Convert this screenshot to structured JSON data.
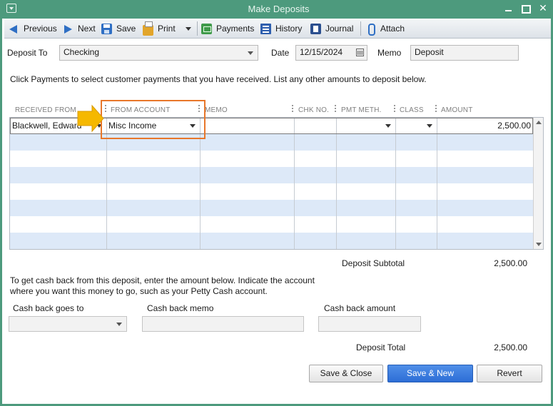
{
  "window": {
    "title": "Make Deposits"
  },
  "toolbar": {
    "previous": "Previous",
    "next": "Next",
    "save": "Save",
    "print": "Print",
    "payments": "Payments",
    "history": "History",
    "journal": "Journal",
    "attach": "Attach"
  },
  "header": {
    "deposit_to_label": "Deposit To",
    "deposit_to_value": "Checking",
    "date_label": "Date",
    "date_value": "12/15/2024",
    "memo_label": "Memo",
    "memo_value": "Deposit"
  },
  "instruction": "Click Payments to select customer payments that you have received. List any other amounts to deposit below.",
  "grid": {
    "columns": [
      "RECEIVED FROM",
      "FROM ACCOUNT",
      "MEMO",
      "CHK NO.",
      "PMT METH.",
      "CLASS",
      "AMOUNT"
    ],
    "rows": [
      {
        "received_from": "Blackwell, Edward",
        "from_account": "Misc Income",
        "memo": "",
        "chk_no": "",
        "pmt_meth": "",
        "class": "",
        "amount": "2,500.00"
      }
    ]
  },
  "totals": {
    "subtotal_label": "Deposit Subtotal",
    "subtotal_value": "2,500.00",
    "total_label": "Deposit Total",
    "total_value": "2,500.00"
  },
  "cash_back": {
    "instruction_line1": "To get cash back from this deposit, enter the amount below.  Indicate the account",
    "instruction_line2": "where you want this money to go, such as your Petty Cash account.",
    "goes_to_label": "Cash back goes to",
    "memo_label": "Cash back memo",
    "amount_label": "Cash back amount"
  },
  "buttons": {
    "save_close": "Save & Close",
    "save_new": "Save & New",
    "revert": "Revert"
  },
  "colors": {
    "titlebar": "#4d9a7d",
    "alt_row": "#dde9f8",
    "highlight": "#e8772a",
    "pointer": "#f5b800",
    "primary_button": "#2d6ed6"
  }
}
